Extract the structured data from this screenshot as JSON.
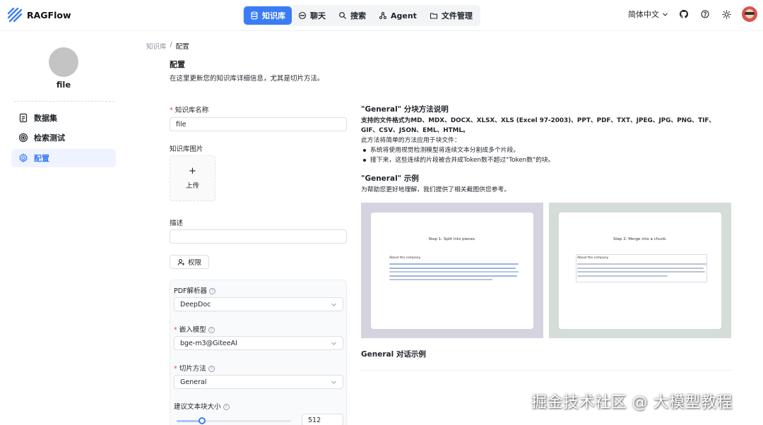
{
  "app": {
    "name": "RAGFlow",
    "brand_color": "#3b7cf6"
  },
  "nav": {
    "items": [
      {
        "label": "知识库",
        "icon": "database-icon",
        "active": true
      },
      {
        "label": "聊天",
        "icon": "chat-icon",
        "active": false
      },
      {
        "label": "搜索",
        "icon": "search-icon",
        "active": false
      },
      {
        "label": "Agent",
        "icon": "agent-icon",
        "active": false
      },
      {
        "label": "文件管理",
        "icon": "folder-icon",
        "active": false
      }
    ]
  },
  "topbar": {
    "language": "简体中文"
  },
  "sidebar": {
    "kb_name": "file",
    "items": [
      {
        "label": "数据集",
        "icon": "dataset-icon",
        "active": false
      },
      {
        "label": "检索测试",
        "icon": "retrieval-test-icon",
        "active": false
      },
      {
        "label": "配置",
        "icon": "gear-icon",
        "active": true
      }
    ]
  },
  "breadcrumb": {
    "root": "知识库",
    "separator": "/",
    "current": "配置"
  },
  "page": {
    "title": "配置",
    "description": "在这里更新您的知识库详细信息，尤其是切片方法。"
  },
  "form": {
    "name_label": "知识库名称",
    "name_value": "file",
    "image_label": "知识库图片",
    "upload_plus": "+",
    "upload_label": "上传",
    "desc_label": "描述",
    "desc_value": "",
    "permission_button": "权限",
    "pdf_parser_label": "PDF解析器",
    "pdf_parser_value": "DeepDoc",
    "embedding_label": "嵌入模型",
    "embedding_value": "bge-m3@GiteeAI",
    "chunk_method_label": "切片方法",
    "chunk_method_value": "General",
    "chunk_size_label": "建议文本块大小",
    "chunk_size_value": "512",
    "chunk_size_fraction": 0.22,
    "help_mark": "?"
  },
  "help": {
    "method_title": "\"General\" 分块方法说明",
    "formats_line": "支持的文件格式为MD、MDX、DOCX、XLSX、XLS (Excel 97-2003)、PPT、PDF、TXT、JPEG、JPG、PNG、TIF、GIF、CSV、JSON、EML、HTML。",
    "intro": "此方法将简单的方法应用于块文件：",
    "bullets": [
      "系统将使用视觉检测模型将连续文本分割成多个片段。",
      "接下来，这些连续的片段被合并成Token数不超过\"Token数\"的块。"
    ],
    "example_title": "\"General\" 示例",
    "example_desc": "为帮助您更好地理解，我们提供了相关截图供您参考。",
    "examples": [
      {
        "step": "Step 1: Split into pieces.",
        "heading": "About the company",
        "bg": "#d6d3e0"
      },
      {
        "step": "Step 2: Merge into a chunk.",
        "heading": "About the company",
        "bg": "#d5ddd8"
      }
    ],
    "dialog_title": "General 对话示例"
  },
  "watermark": "掘金技术社区 @ 大模型教程"
}
